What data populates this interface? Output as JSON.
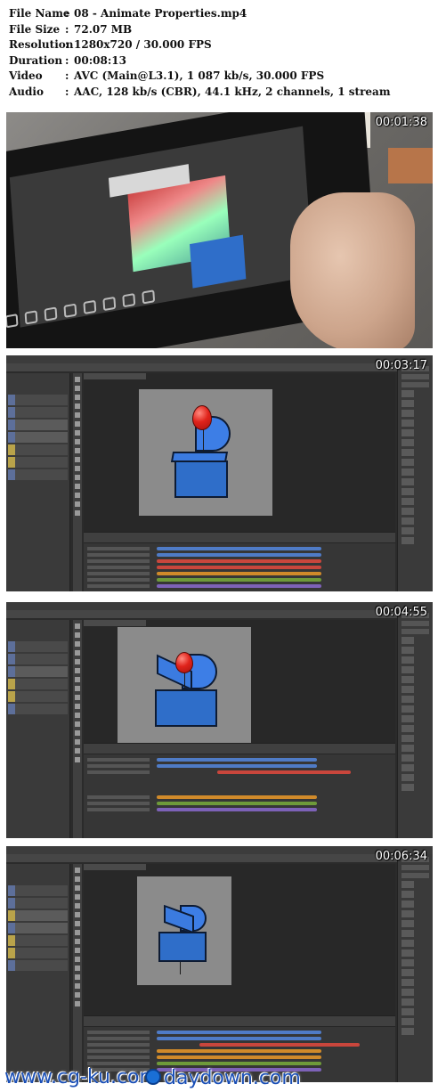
{
  "info": [
    {
      "key": "File Name",
      "value": "08 - Animate Properties.mp4"
    },
    {
      "key": "File Size",
      "value": "72.07 MB"
    },
    {
      "key": "Resolution",
      "value": "1280x720 / 30.000 FPS"
    },
    {
      "key": "Duration",
      "value": "00:08:13"
    },
    {
      "key": "Video",
      "value": "AVC (Main@L3.1), 1 087 kb/s, 30.000 FPS"
    },
    {
      "key": "Audio",
      "value": "AAC, 128 kb/s (CBR), 44.1 kHz, 2 channels, 1 stream"
    }
  ],
  "separator": ":",
  "thumbnails": [
    {
      "timestamp": "00:01:38",
      "kind": "photo"
    },
    {
      "timestamp": "00:03:17",
      "kind": "photoshop"
    },
    {
      "timestamp": "00:04:55",
      "kind": "photoshop"
    },
    {
      "timestamp": "00:06:34",
      "kind": "photoshop"
    }
  ],
  "watermarks": {
    "left": "www.cg-ku.com",
    "right": "daydown.com"
  },
  "colors": {
    "chest_blue": "#2f6ec9",
    "balloon_red": "#e0231b",
    "track_blue": "#4f7bc6",
    "track_red": "#c9463c",
    "track_orange": "#d08a2a",
    "track_green": "#6e9a3a",
    "track_purple": "#7d62b8",
    "watermark_blue": "#1a4fb6"
  }
}
